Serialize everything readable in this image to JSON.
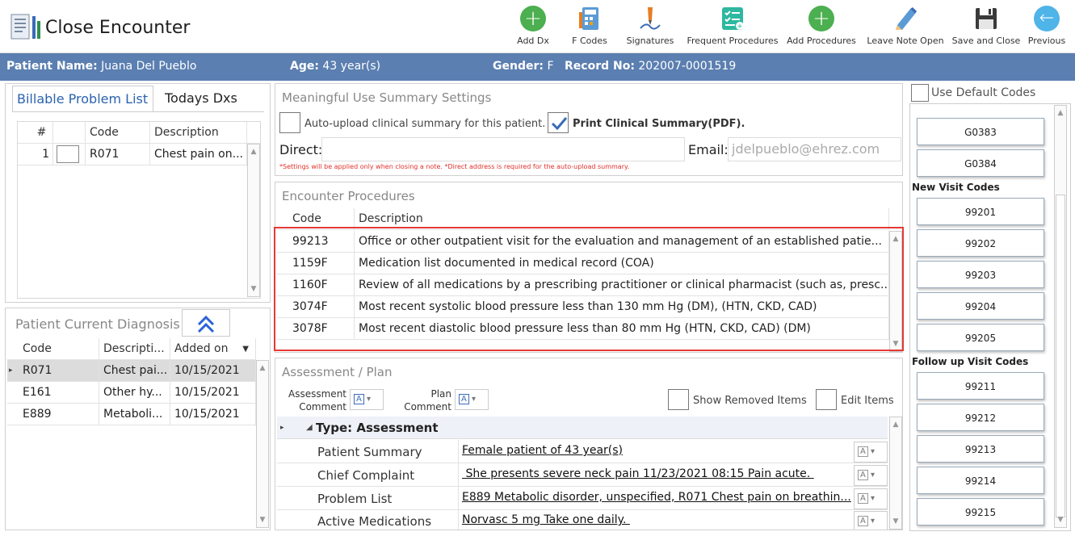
{
  "app": {
    "title": "Close Encounter"
  },
  "toolbar": {
    "add_dx": "Add Dx",
    "f_codes": "F Codes",
    "signatures": "Signatures",
    "frequent_procedures": "Frequent Procedures",
    "add_procedures": "Add Procedures",
    "leave_note_open": "Leave Note Open",
    "save_and_close": "Save and Close",
    "previous": "Previous"
  },
  "patient": {
    "name_label": "Patient Name:",
    "name": "Juana Del Pueblo",
    "age_label": "Age:",
    "age": "43 year(s)",
    "gender_label": "Gender:",
    "gender": "F",
    "record_label": "Record No:",
    "record": "202007-0001519"
  },
  "problem_tabs": {
    "billable": "Billable Problem List",
    "todays": "Todays Dxs"
  },
  "billable_grid": {
    "headers": [
      "#",
      "Code",
      "Description"
    ],
    "rows": [
      {
        "num": "1",
        "code": "R071",
        "desc": "Chest pain on..."
      }
    ]
  },
  "current_dx": {
    "title": "Patient Current Diagnosis",
    "headers": [
      "Code",
      "Descripti...",
      "Added on"
    ],
    "rows": [
      {
        "code": "R071",
        "desc": "Chest pai...",
        "date": "10/15/2021"
      },
      {
        "code": "E161",
        "desc": "Other hy...",
        "date": "10/15/2021"
      },
      {
        "code": "E889",
        "desc": "Metaboli...",
        "date": "10/15/2021"
      }
    ]
  },
  "mu": {
    "title": "Meaningful Use Summary Settings",
    "auto_upload": "Auto-upload clinical summary for this patient.",
    "print_summary": "Print Clinical Summary(PDF).",
    "direct_label": "Direct:",
    "direct_value": "",
    "email_label": "Email:",
    "email_value": "jdelpueblo@ehrez.com",
    "note": "*Settings will be applied only when closing a note.   *Direct address is required for the auto-upload summary."
  },
  "procedures": {
    "title": "Encounter Procedures",
    "headers": [
      "Code",
      "Description"
    ],
    "rows": [
      {
        "code": "99213",
        "desc": "Office or other outpatient visit for the evaluation and management of an established patie..."
      },
      {
        "code": "1159F",
        "desc": "Medication list documented in medical record (COA)"
      },
      {
        "code": "1160F",
        "desc": "Review of all medications by a prescribing practitioner or clinical pharmacist (such as, presc..."
      },
      {
        "code": "3074F",
        "desc": "Most recent systolic blood pressure less than 130 mm Hg (DM), (HTN, CKD, CAD)"
      },
      {
        "code": "3078F",
        "desc": "Most recent diastolic blood pressure less than 80 mm Hg (HTN, CKD, CAD) (DM)"
      }
    ]
  },
  "assessment": {
    "title": "Assessment / Plan",
    "assessment_comment_1": "Assessment",
    "assessment_comment_2": "Comment",
    "plan_comment_1": "Plan",
    "plan_comment_2": "Comment",
    "show_removed": "Show Removed Items",
    "edit_items": "Edit Items",
    "group": "Type: Assessment",
    "rows": [
      {
        "label": "Patient Summary",
        "value": "Female patient of 43 year(s)"
      },
      {
        "label": "Chief Complaint",
        "value": " She presents severe neck pain 11/23/2021 08:15 Pain acute. "
      },
      {
        "label": "Problem List",
        "value": "E889 Metabolic disorder, unspecified, R071 Chest pain on breathin..."
      },
      {
        "label": "Active Medications",
        "value": "Norvasc 5 mg Take one daily. "
      }
    ]
  },
  "codes": {
    "use_default": "Use Default Codes",
    "top": [
      "G0383",
      "G0384"
    ],
    "new_visit_title": "New Visit Codes",
    "new_visit": [
      "99201",
      "99202",
      "99203",
      "99204",
      "99205"
    ],
    "follow_up_title": "Follow up Visit Codes",
    "follow_up": [
      "99211",
      "99212",
      "99213",
      "99214",
      "99215"
    ]
  },
  "colors": {
    "header_bar": "#5b7fb1",
    "highlight": "#e53935",
    "green": "#4caf50"
  }
}
